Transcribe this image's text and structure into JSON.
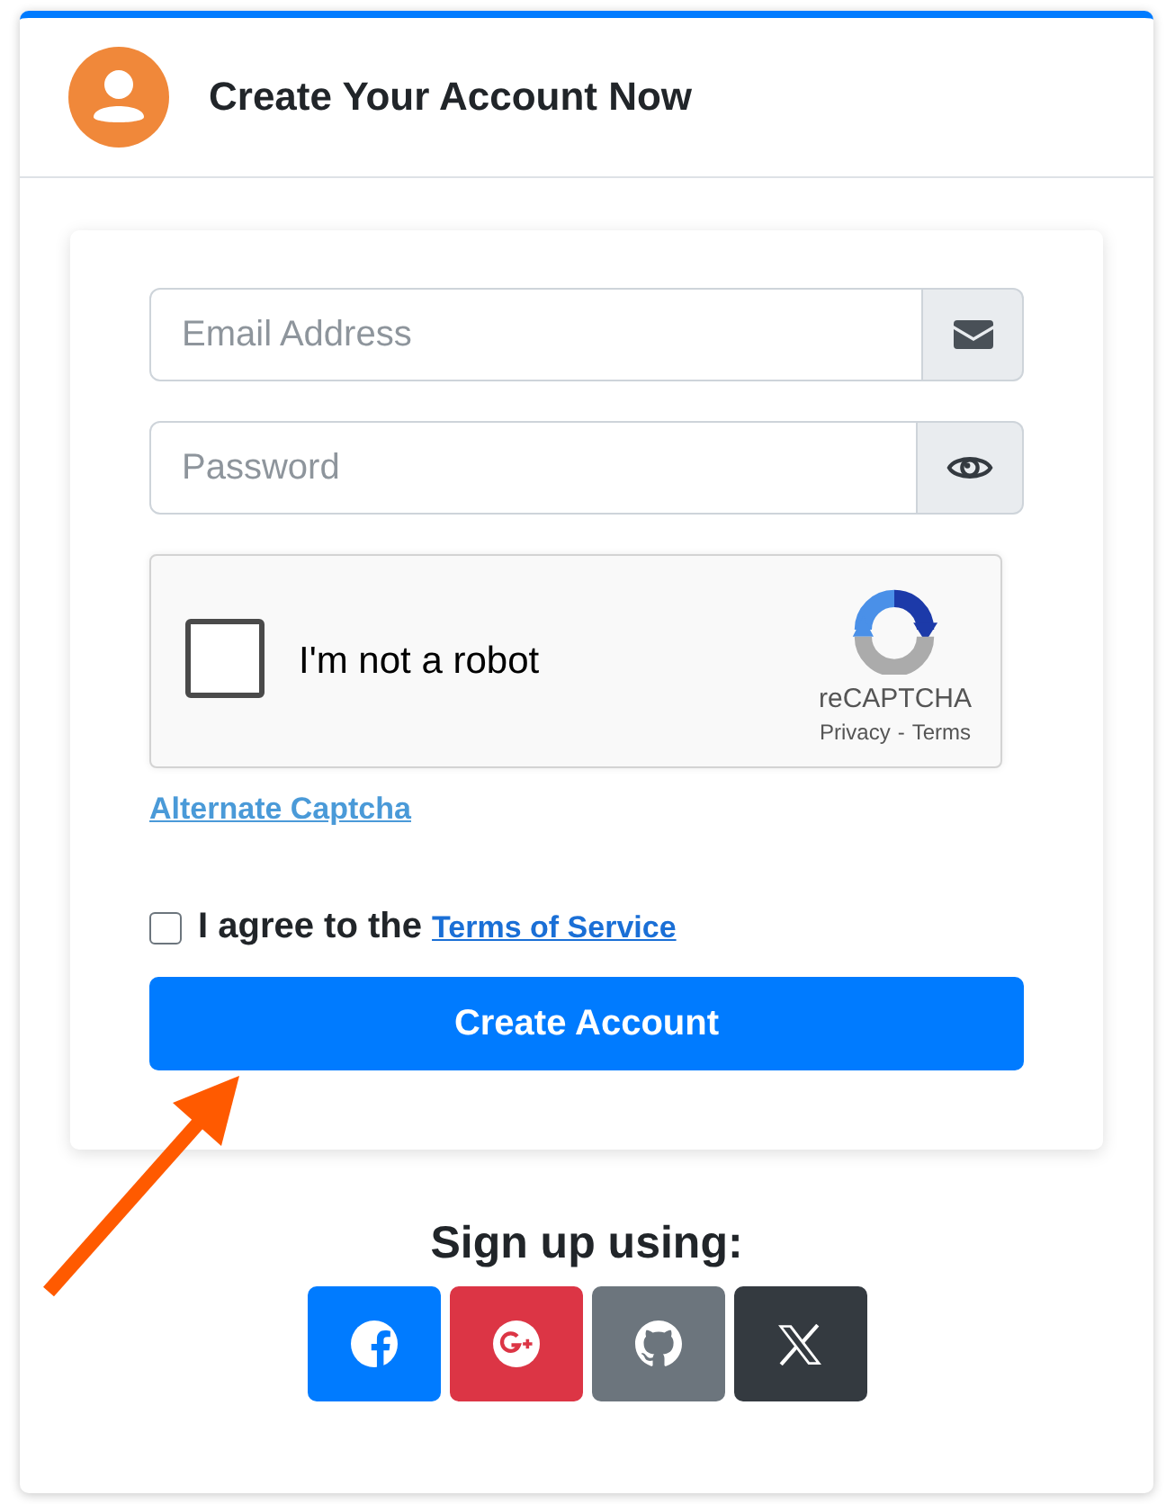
{
  "header": {
    "title": "Create Your Account Now"
  },
  "form": {
    "email": {
      "placeholder": "Email Address"
    },
    "password": {
      "placeholder": "Password"
    },
    "captcha": {
      "label": "I'm not a robot",
      "checked": false,
      "brand": "reCAPTCHA",
      "privacy_link": "Privacy",
      "separator": "-",
      "terms_link": "Terms"
    },
    "alternate_captcha_link": "Alternate Captcha",
    "agree": {
      "checked": false,
      "text": "I agree to the",
      "link": "Terms of Service"
    },
    "submit_button": "Create Account"
  },
  "social": {
    "heading": "Sign up using:",
    "buttons": [
      {
        "kind": "facebook",
        "color": "#007bff"
      },
      {
        "kind": "google",
        "color": "#dc3545"
      },
      {
        "kind": "github",
        "color": "#6c757d"
      },
      {
        "kind": "x",
        "color": "#343a40"
      }
    ]
  }
}
